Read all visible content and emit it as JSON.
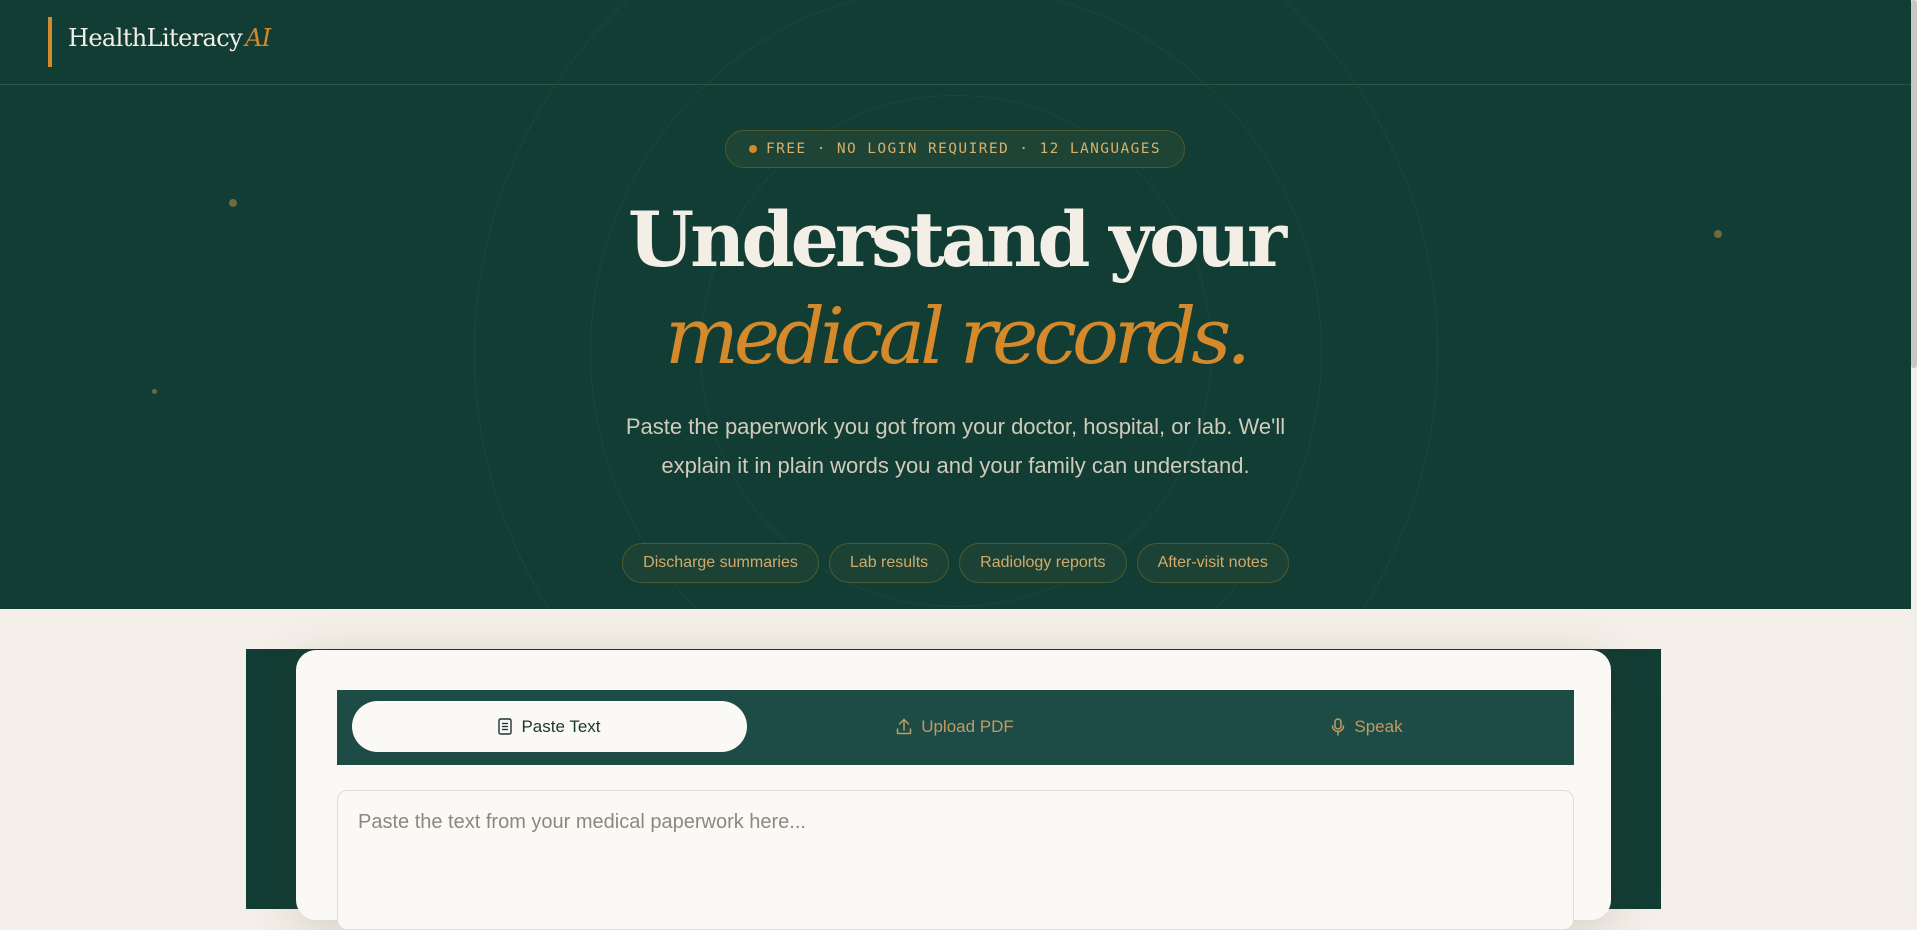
{
  "header": {
    "logo_main": "HealthLiteracy",
    "logo_accent": "AI"
  },
  "hero": {
    "badge": "FREE · NO LOGIN REQUIRED · 12 LANGUAGES",
    "headline_line1": "Understand your",
    "headline_line2": "medical records.",
    "subtitle": "Paste the paperwork you got from your doctor, hospital, or lab. We'll explain it in plain words you and your family can understand.",
    "chips": [
      "Discharge summaries",
      "Lab results",
      "Radiology reports",
      "After-visit notes"
    ]
  },
  "input_card": {
    "tabs": [
      {
        "label": "Paste Text",
        "icon": "document-icon",
        "active": true
      },
      {
        "label": "Upload PDF",
        "icon": "upload-icon",
        "active": false
      },
      {
        "label": "Speak",
        "icon": "microphone-icon",
        "active": false
      }
    ],
    "textarea_placeholder": "Paste the text from your medical paperwork here..."
  },
  "colors": {
    "hero_bg": "#123d34",
    "accent": "#d4892a",
    "page_bg": "#f4f0e9",
    "card_bg": "#faf9f6",
    "tab_bar_bg": "#1c4c45"
  }
}
